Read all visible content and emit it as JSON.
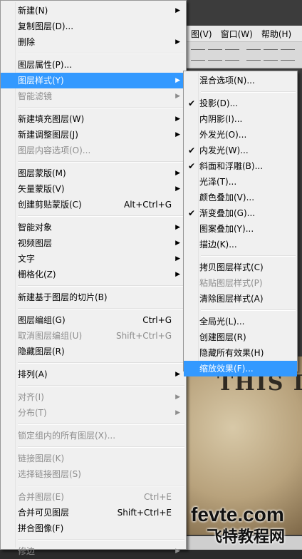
{
  "background": {
    "menubar": [
      "图(V)",
      "窗口(W)",
      "帮助(H)"
    ],
    "canvas_text": "THIS I",
    "watermark": {
      "line1": "fevte.com",
      "line2": "飞特教程网"
    }
  },
  "main_menu": {
    "items": [
      {
        "label": "新建(N)",
        "submenu": true
      },
      {
        "label": "复制图层(D)...",
        "submenu": false
      },
      {
        "label": "删除",
        "submenu": true
      },
      {
        "sep": true
      },
      {
        "label": "图层属性(P)...",
        "submenu": false
      },
      {
        "label": "图层样式(Y)",
        "submenu": true,
        "selected": true
      },
      {
        "label": "智能滤镜",
        "submenu": true,
        "disabled": true
      },
      {
        "sep": true
      },
      {
        "label": "新建填充图层(W)",
        "submenu": true
      },
      {
        "label": "新建调整图层(J)",
        "submenu": true
      },
      {
        "label": "图层内容选项(O)...",
        "submenu": false,
        "disabled": true
      },
      {
        "sep": true
      },
      {
        "label": "图层蒙版(M)",
        "submenu": true
      },
      {
        "label": "矢量蒙版(V)",
        "submenu": true
      },
      {
        "label": "创建剪贴蒙版(C)",
        "shortcut": "Alt+Ctrl+G",
        "submenu": false
      },
      {
        "sep": true
      },
      {
        "label": "智能对象",
        "submenu": true
      },
      {
        "label": "视频图层",
        "submenu": true
      },
      {
        "label": "文字",
        "submenu": true
      },
      {
        "label": "栅格化(Z)",
        "submenu": true
      },
      {
        "sep": true
      },
      {
        "label": "新建基于图层的切片(B)",
        "submenu": false
      },
      {
        "sep": true
      },
      {
        "label": "图层编组(G)",
        "shortcut": "Ctrl+G",
        "submenu": false
      },
      {
        "label": "取消图层编组(U)",
        "shortcut": "Shift+Ctrl+G",
        "submenu": false,
        "disabled": true
      },
      {
        "label": "隐藏图层(R)",
        "submenu": false
      },
      {
        "sep": true
      },
      {
        "label": "排列(A)",
        "submenu": true
      },
      {
        "sep": true
      },
      {
        "label": "对齐(I)",
        "submenu": true,
        "disabled": true
      },
      {
        "label": "分布(T)",
        "submenu": true,
        "disabled": true
      },
      {
        "sep": true
      },
      {
        "label": "锁定组内的所有图层(X)...",
        "submenu": false,
        "disabled": true
      },
      {
        "sep": true
      },
      {
        "label": "链接图层(K)",
        "submenu": false,
        "disabled": true
      },
      {
        "label": "选择链接图层(S)",
        "submenu": false,
        "disabled": true
      },
      {
        "sep": true
      },
      {
        "label": "合并图层(E)",
        "shortcut": "Ctrl+E",
        "submenu": false,
        "disabled": true
      },
      {
        "label": "合并可见图层",
        "shortcut": "Shift+Ctrl+E",
        "submenu": false
      },
      {
        "label": "拼合图像(F)",
        "submenu": false
      },
      {
        "sep": true
      },
      {
        "label": "修边",
        "submenu": true,
        "disabled": true
      }
    ]
  },
  "sub_menu": {
    "items": [
      {
        "label": "混合选项(N)..."
      },
      {
        "sep": true
      },
      {
        "label": "投影(D)...",
        "checked": true
      },
      {
        "label": "内阴影(I)..."
      },
      {
        "label": "外发光(O)..."
      },
      {
        "label": "内发光(W)...",
        "checked": true
      },
      {
        "label": "斜面和浮雕(B)...",
        "checked": true
      },
      {
        "label": "光泽(T)..."
      },
      {
        "label": "颜色叠加(V)..."
      },
      {
        "label": "渐变叠加(G)...",
        "checked": true
      },
      {
        "label": "图案叠加(Y)..."
      },
      {
        "label": "描边(K)..."
      },
      {
        "sep": true
      },
      {
        "label": "拷贝图层样式(C)"
      },
      {
        "label": "粘贴图层样式(P)",
        "disabled": true
      },
      {
        "label": "清除图层样式(A)"
      },
      {
        "sep": true
      },
      {
        "label": "全局光(L)..."
      },
      {
        "label": "创建图层(R)"
      },
      {
        "label": "隐藏所有效果(H)"
      },
      {
        "label": "缩放效果(F)...",
        "selected": true
      }
    ]
  },
  "icons": {
    "check": "checkmark-icon",
    "submenu": "triangle-right-icon"
  },
  "colors": {
    "highlight": "#3399ff",
    "menu_bg": "#f0f0f0",
    "disabled_text": "#8d8d8d"
  }
}
